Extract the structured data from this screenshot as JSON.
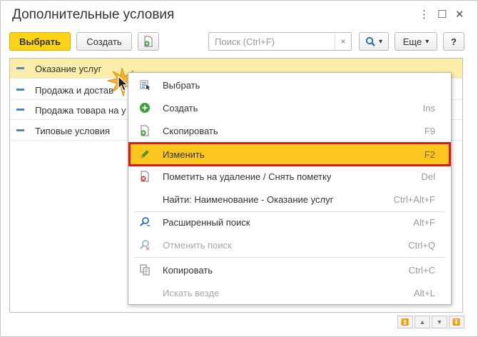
{
  "window": {
    "title": "Дополнительные условия",
    "controls": {
      "more": "⋮",
      "maximize": "☐",
      "close": "✕"
    }
  },
  "toolbar": {
    "select_label": "Выбрать",
    "create_label": "Создать",
    "search_placeholder": "Поиск (Ctrl+F)",
    "clear_label": "×",
    "search_dropdown_caret": "▾",
    "more_label": "Еще",
    "more_caret": "▾",
    "help_label": "?"
  },
  "list": {
    "items": [
      {
        "label": "Оказание услуг"
      },
      {
        "label": "Продажа и достав"
      },
      {
        "label": "Продажа товара на у"
      },
      {
        "label": "Типовые условия"
      }
    ]
  },
  "context_menu": {
    "items": [
      {
        "label": "Выбрать",
        "shortcut": ""
      },
      {
        "label": "Создать",
        "shortcut": "Ins"
      },
      {
        "label": "Скопировать",
        "shortcut": "F9"
      },
      {
        "label": "Изменить",
        "shortcut": "F2"
      },
      {
        "label": "Пометить на удаление / Снять пометку",
        "shortcut": "Del"
      },
      {
        "label": "Найти: Наименование - Оказание услуг",
        "shortcut": "Ctrl+Alt+F"
      },
      {
        "label": "Расширенный поиск",
        "shortcut": "Alt+F"
      },
      {
        "label": "Отменить поиск",
        "shortcut": "Ctrl+Q"
      },
      {
        "label": "Копировать",
        "shortcut": "Ctrl+C"
      },
      {
        "label": "Искать везде",
        "shortcut": "Alt+L"
      }
    ]
  },
  "navigation": {
    "first": "⏫",
    "up": "▲",
    "down": "▼",
    "last": "⏬"
  },
  "colors": {
    "accent": "#fbd416",
    "menu_active": "#fbc61e",
    "highlight_frame": "#dc1c1c",
    "selected_row": "#fbeea8"
  }
}
